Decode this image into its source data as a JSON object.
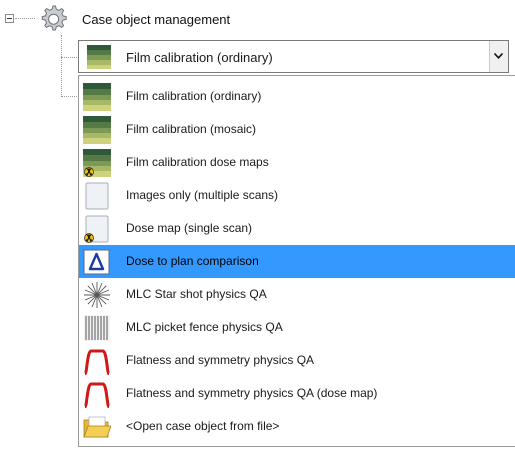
{
  "tree": {
    "root_label": "Case object management",
    "root_icon": "gear-icon"
  },
  "combo": {
    "selected_label": "Film calibration (ordinary)",
    "selected_icon": "film-calibration-icon",
    "dropdown_icon": "chevron-down-icon"
  },
  "dropdown": {
    "selected_index": 5,
    "highlight_color": "#3399ff",
    "items": [
      {
        "label": "Film calibration (ordinary)",
        "icon": "film-calibration-icon"
      },
      {
        "label": "Film calibration (mosaic)",
        "icon": "film-calibration-mosaic-icon"
      },
      {
        "label": "Film calibration dose maps",
        "icon": "film-calibration-dose-maps-icon"
      },
      {
        "label": "Images only (multiple scans)",
        "icon": "blank-document-icon"
      },
      {
        "label": "Dose map (single scan)",
        "icon": "dose-map-document-icon"
      },
      {
        "label": "Dose to plan comparison",
        "icon": "delta-icon"
      },
      {
        "label": "MLC Star shot physics QA",
        "icon": "star-shot-icon"
      },
      {
        "label": "MLC picket fence physics QA",
        "icon": "picket-fence-icon"
      },
      {
        "label": "Flatness and symmetry physics QA",
        "icon": "beam-profile-icon"
      },
      {
        "label": "Flatness and symmetry physics QA (dose map)",
        "icon": "beam-profile-dose-map-icon"
      },
      {
        "label": "<Open case object from file>",
        "icon": "folder-open-icon"
      }
    ]
  }
}
